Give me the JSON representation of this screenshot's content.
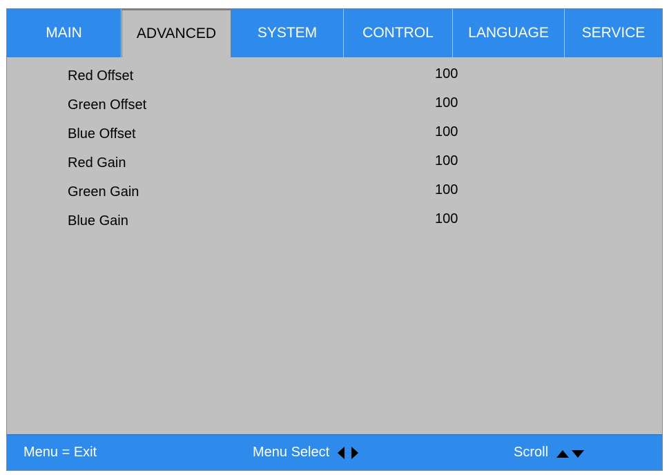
{
  "tabs": [
    {
      "label": "MAIN",
      "active": false
    },
    {
      "label": "ADVANCED",
      "active": true
    },
    {
      "label": "SYSTEM",
      "active": false
    },
    {
      "label": "CONTROL",
      "active": false
    },
    {
      "label": "LANGUAGE",
      "active": false
    },
    {
      "label": "SERVICE",
      "active": false
    }
  ],
  "menu": {
    "items": [
      {
        "label": "Red Offset",
        "value": "100"
      },
      {
        "label": "Green Offset",
        "value": "100"
      },
      {
        "label": "Blue Offset",
        "value": "100"
      },
      {
        "label": "Red Gain",
        "value": "100"
      },
      {
        "label": "Green Gain",
        "value": "100"
      },
      {
        "label": "Blue Gain",
        "value": "100"
      }
    ]
  },
  "footer": {
    "exit_hint": "Menu = Exit",
    "select_hint": "Menu Select",
    "scroll_hint": "Scroll",
    "select_icon": "left-right-arrows-icon",
    "scroll_icon": "up-down-arrows-icon"
  },
  "colors": {
    "tab_blue": "#2e8bec",
    "panel_gray": "#c0c0c0",
    "footer_blue": "#2e8bec"
  }
}
